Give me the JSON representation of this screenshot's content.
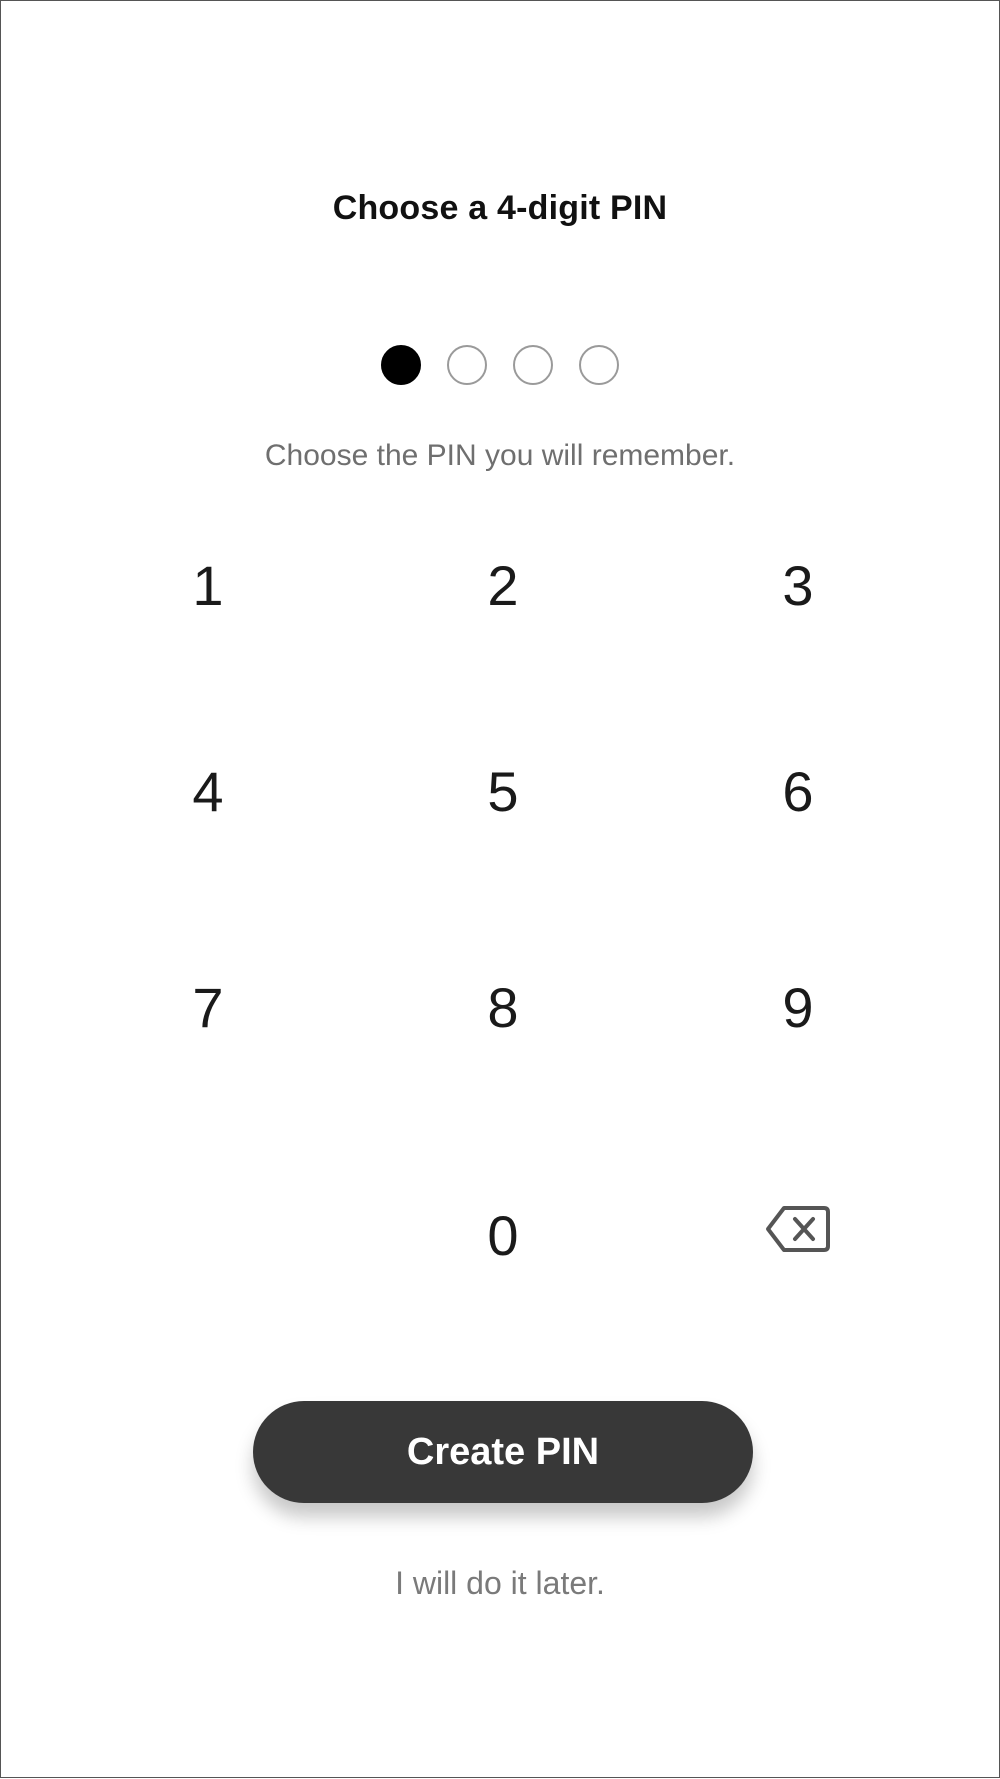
{
  "title": "Choose a 4-digit PIN",
  "pin_indicator": {
    "length": 4,
    "filled": 1
  },
  "subtitle": "Choose the PIN you will remember.",
  "keypad": {
    "keys": [
      "1",
      "2",
      "3",
      "4",
      "5",
      "6",
      "7",
      "8",
      "9",
      "0"
    ],
    "backspace_icon": "backspace-icon"
  },
  "actions": {
    "create_pin_label": "Create PIN",
    "later_label": "I will do it later."
  }
}
